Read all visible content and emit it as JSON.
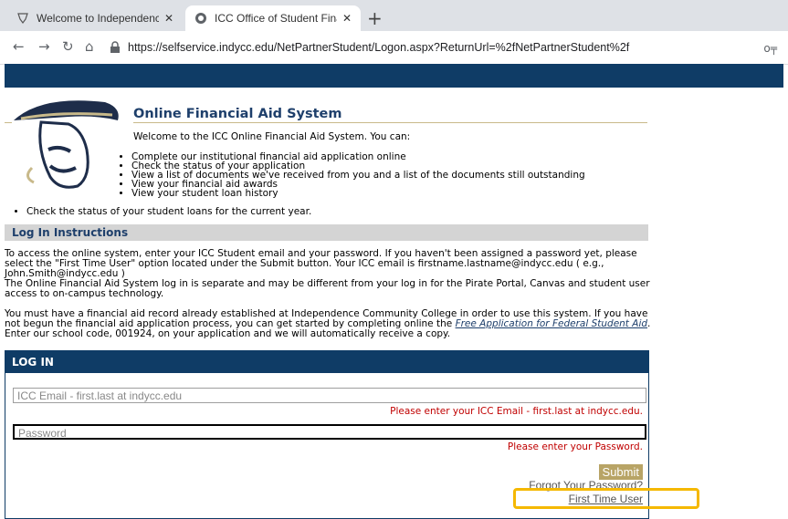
{
  "browser": {
    "tabs": [
      {
        "title": "Welcome to Independence Comm",
        "active": false
      },
      {
        "title": "ICC Office of Student Financial A",
        "active": true
      }
    ],
    "url": "https://selfservice.indycc.edu/NetPartnerStudent/Logon.aspx?ReturnUrl=%2fNetPartnerStudent%2f"
  },
  "header": {
    "title": "Online Financial Aid System",
    "welcome": "Welcome to the ICC Online Financial Aid System. You can:"
  },
  "features": [
    "Complete our institutional financial aid application online",
    "Check the status of your application",
    "View a list of documents we've received from you and a list of the documents still outstanding",
    "View your financial aid awards",
    "View your student loan history"
  ],
  "extra_feature": "Check the status of your student loans for the current year.",
  "instructions": {
    "heading": "Log In Instructions",
    "p1": "To access the online system, enter your ICC Student email and your password. If you haven't been assigned a password yet, please select the \"First Time User\" option located under the Submit button. Your ICC email is firstname.lastname@indycc.edu ( e.g., John.Smith@indycc.edu )",
    "p2": "The Online Financial Aid System log in is separate and may be different from your log in for the Pirate Portal, Canvas and student user access to on-campus technology.",
    "p3_before": "You must have a financial aid record already established at Independence Community College in order to use this system. If you have not begun the financial aid application process, you can get started by completing online the ",
    "p3_link": "Free Application for Federal Student Aid",
    "p3_after": ". Enter our school code, 001924, on your application and we will automatically receive a copy."
  },
  "login": {
    "heading": "LOG IN",
    "email_placeholder": "ICC Email - first.last at indycc.edu",
    "email_error": "Please enter your ICC Email - first.last at indycc.edu.",
    "password_placeholder": "Password",
    "password_error": "Please enter your Password.",
    "submit_label": "Submit",
    "forgot_label": "Forgot Your Password?",
    "first_time_label": "First Time User"
  },
  "colors": {
    "brand_navy": "#0f3c66",
    "error_red": "#c00000",
    "submit_gold": "#b8a466",
    "highlight": "#f5b800"
  }
}
